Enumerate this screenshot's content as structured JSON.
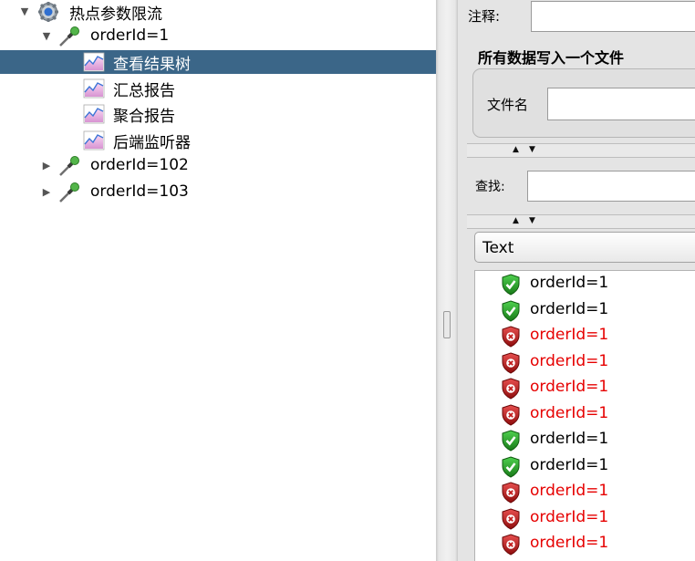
{
  "tree": {
    "root": {
      "label": "热点参数限流"
    },
    "sampler1": {
      "label": "orderId=1"
    },
    "listeners": [
      {
        "label": "查看结果树",
        "selected": true
      },
      {
        "label": "汇总报告",
        "selected": false
      },
      {
        "label": "聚合报告",
        "selected": false
      },
      {
        "label": "后端监听器",
        "selected": false
      }
    ],
    "sampler2": {
      "label": "orderId=102"
    },
    "sampler3": {
      "label": "orderId=103"
    },
    "selected_bg": "#3b6688"
  },
  "panel": {
    "comment_label": "注释:",
    "group_title": "所有数据写入一个文件",
    "filename_label": "文件名",
    "search_label": "查找:",
    "renderer_value": "Text"
  },
  "results": [
    {
      "text": "orderId=1",
      "status": "success"
    },
    {
      "text": "orderId=1",
      "status": "success"
    },
    {
      "text": "orderId=1",
      "status": "error"
    },
    {
      "text": "orderId=1",
      "status": "error"
    },
    {
      "text": "orderId=1",
      "status": "error"
    },
    {
      "text": "orderId=1",
      "status": "error"
    },
    {
      "text": "orderId=1",
      "status": "success"
    },
    {
      "text": "orderId=1",
      "status": "success"
    },
    {
      "text": "orderId=1",
      "status": "error"
    },
    {
      "text": "orderId=1",
      "status": "error"
    },
    {
      "text": "orderId=1",
      "status": "error"
    }
  ],
  "colors": {
    "success": "#2e9d2e",
    "error": "#e60000"
  }
}
